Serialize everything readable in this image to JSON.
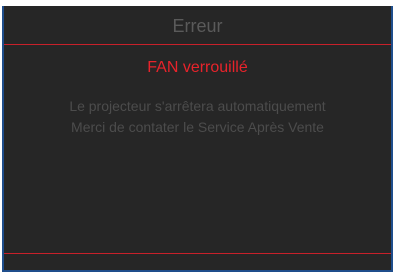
{
  "dialog": {
    "title": "Erreur",
    "error_label": "FAN verrouillé",
    "message_lines": [
      "Le projecteur s'arrêtera automatiquement",
      "Merci de contater le Service Après Vente"
    ]
  },
  "colors": {
    "background": "#262626",
    "title_text": "#5a5a5a",
    "error_text": "#e8232b",
    "rule": "#c8202a",
    "message_text": "#4c4c4c",
    "frame": "#1f4e8c"
  }
}
